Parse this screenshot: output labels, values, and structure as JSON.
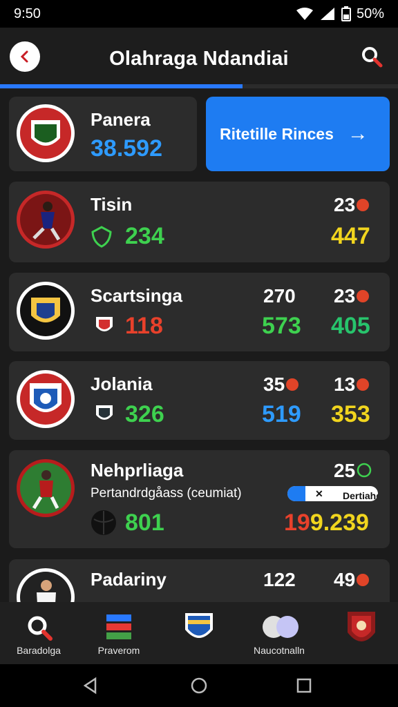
{
  "status_bar": {
    "time": "9:50",
    "battery": "50%"
  },
  "header": {
    "title": "Olahraga Ndandiai",
    "progress_fraction": 0.61
  },
  "summary_card": {
    "name": "Panera",
    "value": "38.592"
  },
  "cta_button": {
    "label": "Ritetille Rinces"
  },
  "cards": [
    {
      "name": "Tisin",
      "value": "234",
      "stat_a": "",
      "stat_a_value": "",
      "stat_b": "23",
      "stat_b_value": "447"
    },
    {
      "name": "Scartsinga",
      "value": "118",
      "stat_a": "270",
      "stat_a_value": "573",
      "stat_b": "23",
      "stat_b_value": "405"
    },
    {
      "name": "Jolania",
      "value": "326",
      "stat_a": "35",
      "stat_a_value": "519",
      "stat_b": "13",
      "stat_b_value": "353"
    },
    {
      "name": "Nehprliaga",
      "subtitle": "Pertandrdgåass (ceumiat)",
      "value": "801",
      "stat_b": "25",
      "toggle_label": "Dertiahdac",
      "combined_left": "19",
      "combined_right": "9.239"
    },
    {
      "name": "Padariny",
      "stat_a": "122",
      "stat_b": "49"
    }
  ],
  "bottom_nav": [
    {
      "label": "Baradolga",
      "icon": "search-icon"
    },
    {
      "label": "Praverom",
      "icon": "stats-icon"
    },
    {
      "label": "",
      "icon": "crest-icon"
    },
    {
      "label": "Naucotnalln",
      "icon": "balls-icon"
    },
    {
      "label": "",
      "icon": "shield-icon"
    }
  ]
}
